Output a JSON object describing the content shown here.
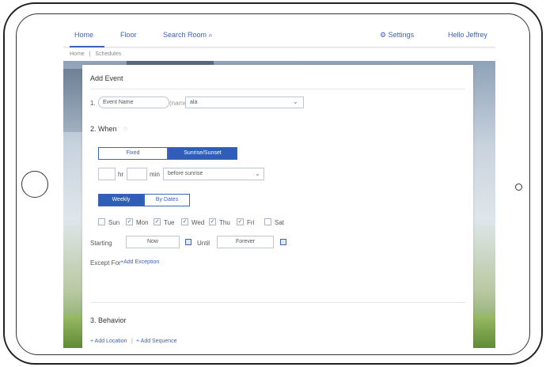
{
  "nav": {
    "items": [
      "Home",
      "Floor",
      "Search Room"
    ],
    "search_icon": "search-icon",
    "settings_label": "Settings",
    "settings_icon": "gear-icon",
    "greeting": "Hello Jeffrey"
  },
  "breadcrumb": [
    "Home",
    "|",
    "Schedules"
  ],
  "card": {
    "title": "Add Event",
    "step1": {
      "number": "1.",
      "name_placeholder": "Event Name",
      "joiner": "(name)",
      "select_value": "ala"
    },
    "step2": {
      "title": "2. When",
      "time_mode": [
        "Fixed",
        "Sunrise/Sunset"
      ],
      "hours_label": "hr",
      "minutes_label": "min",
      "offset_select": "before sunrise",
      "repeat_mode": [
        "Weekly",
        "By Dates"
      ],
      "days": [
        {
          "label": "Sun",
          "checked": false
        },
        {
          "label": "Mon",
          "checked": true
        },
        {
          "label": "Tue",
          "checked": true
        },
        {
          "label": "Wed",
          "checked": true
        },
        {
          "label": "Thu",
          "checked": true
        },
        {
          "label": "Fri",
          "checked": true
        },
        {
          "label": "Sat",
          "checked": false
        }
      ],
      "starting_label": "Starting",
      "starting_value": "Now",
      "until_label": "Until",
      "until_value": "Forever",
      "except_label": "Except For",
      "add_exception": "+Add Exception"
    },
    "step3": {
      "title": "3. Behavior",
      "add_location": "+ Add Location",
      "divider": "|",
      "add_sequence": "+ Add Sequence"
    }
  },
  "colors": {
    "accent": "#2f5db8",
    "link": "#3f63b7"
  }
}
